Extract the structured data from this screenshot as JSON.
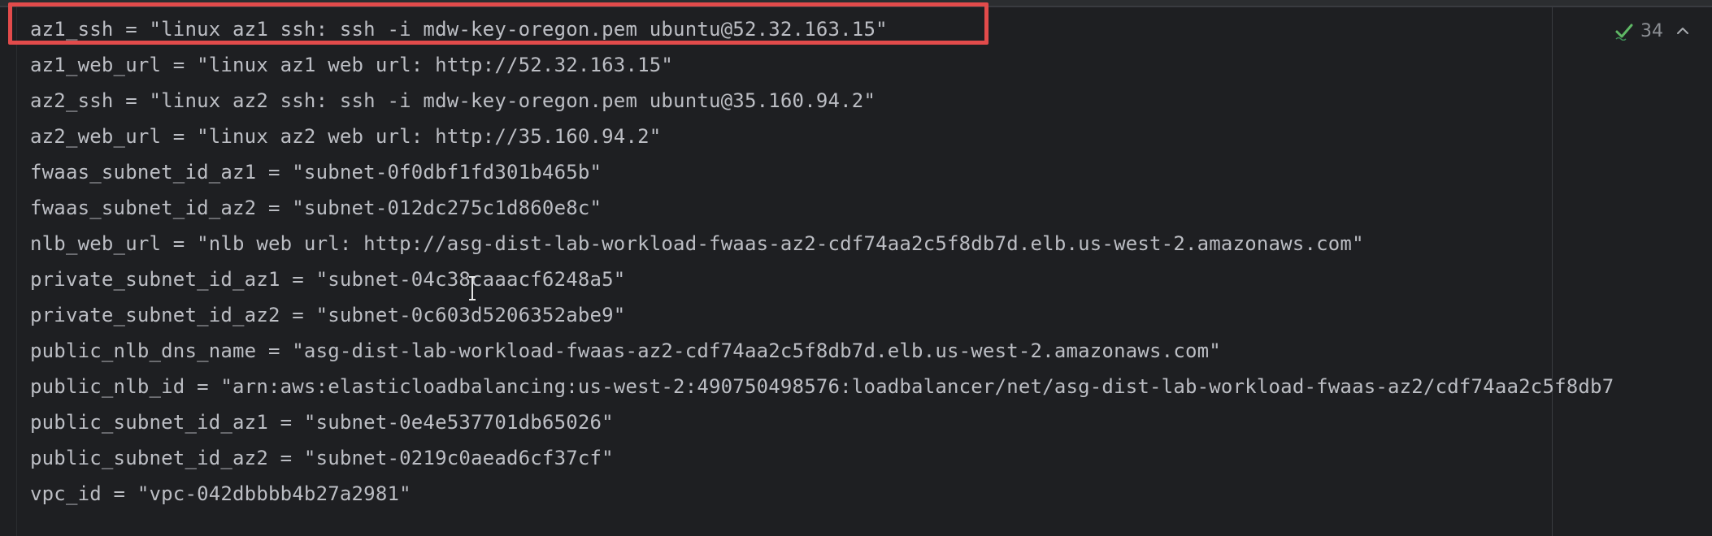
{
  "editor": {
    "lines": [
      "az1_ssh = \"linux az1 ssh: ssh -i mdw-key-oregon.pem ubuntu@52.32.163.15\"",
      "az1_web_url = \"linux az1 web url: http://52.32.163.15\"",
      "az2_ssh = \"linux az2 ssh: ssh -i mdw-key-oregon.pem ubuntu@35.160.94.2\"",
      "az2_web_url = \"linux az2 web url: http://35.160.94.2\"",
      "fwaas_subnet_id_az1 = \"subnet-0f0dbf1fd301b465b\"",
      "fwaas_subnet_id_az2 = \"subnet-012dc275c1d860e8c\"",
      "nlb_web_url = \"nlb web url: http://asg-dist-lab-workload-fwaas-az2-cdf74aa2c5f8db7d.elb.us-west-2.amazonaws.com\"",
      "private_subnet_id_az1 = \"subnet-04c38caaacf6248a5\"",
      "private_subnet_id_az2 = \"subnet-0c603d5206352abe9\"",
      "public_nlb_dns_name = \"asg-dist-lab-workload-fwaas-az2-cdf74aa2c5f8db7d.elb.us-west-2.amazonaws.com\"",
      "public_nlb_id = \"arn:aws:elasticloadbalancing:us-west-2:490750498576:loadbalancer/net/asg-dist-lab-workload-fwaas-az2/cdf74aa2c5f8db7",
      "public_subnet_id_az1 = \"subnet-0e4e537701db65026\"",
      "public_subnet_id_az2 = \"subnet-0219c0aead6cf37cf\"",
      "vpc_id = \"vpc-042dbbbb4b27a2981\""
    ]
  },
  "inspections": {
    "count": "34",
    "status_icon": "check-icon",
    "collapse_icon": "chevron-up-icon"
  },
  "colors": {
    "background": "#1e1f22",
    "text": "#bcbec4",
    "highlight_border": "#e24b4b",
    "check": "#5fb865"
  }
}
